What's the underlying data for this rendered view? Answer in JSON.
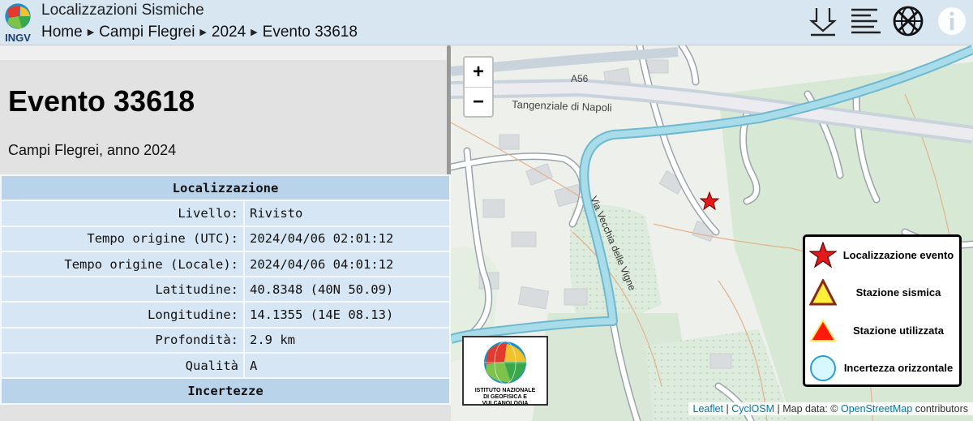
{
  "header": {
    "logo_text": "INGV",
    "app_title": "Localizzazioni Sismiche",
    "breadcrumb": [
      "Home",
      "Campi Flegrei",
      "2024",
      "Evento 33618"
    ],
    "icons": [
      "download-icon",
      "list-icon",
      "globe-off-icon",
      "info-icon"
    ]
  },
  "event": {
    "title": "Evento 33618",
    "subtitle": "Campi Flegrei, anno 2024"
  },
  "localization": {
    "heading": "Localizzazione",
    "rows": [
      {
        "label": "Livello:",
        "value": "Rivisto"
      },
      {
        "label": "Tempo origine (UTC):",
        "value": "2024/04/06 02:01:12"
      },
      {
        "label": "Tempo origine (Locale):",
        "value": "2024/04/06 04:01:12"
      },
      {
        "label": "Latitudine:",
        "value": "40.8348 (40N 50.09)"
      },
      {
        "label": "Longitudine:",
        "value": "14.1355 (14E 08.13)"
      },
      {
        "label": "Profondità:",
        "value": "2.9 km"
      },
      {
        "label": "Qualità",
        "value": "A"
      }
    ],
    "next_heading": "Incertezze"
  },
  "map": {
    "zoom_in": "+",
    "zoom_out": "−",
    "labels": {
      "road_a56": "A56",
      "tangenziale": "Tangenziale di Napoli",
      "via_vecchia": "Via Vecchia delle Vigne"
    },
    "ingv_name_line1": "ISTITUTO NAZIONALE",
    "ingv_name_line2": "DI GEOFISICA E VULCANOLOGIA",
    "legend": [
      {
        "label": "Localizzazione evento",
        "symbol": "red-star"
      },
      {
        "label": "Stazione sismica",
        "symbol": "yellow-triangle"
      },
      {
        "label": "Stazione utilizzata",
        "symbol": "red-triangle"
      },
      {
        "label": "Incertezza orizzontale",
        "symbol": "light-blue-circle"
      }
    ],
    "attribution": {
      "leaflet": "Leaflet",
      "sep1": " | ",
      "cyclosm": "CyclOSM",
      "mapdata": " | Map data: © ",
      "osm": "OpenStreetMap",
      "contrib": " contributors"
    }
  },
  "colors": {
    "header_bg": "#d8e6f2",
    "table_header": "#b9d3ea",
    "table_cell": "#d6e6f4",
    "event_star": "#e31a1c",
    "main_road": "#a8dce8"
  }
}
